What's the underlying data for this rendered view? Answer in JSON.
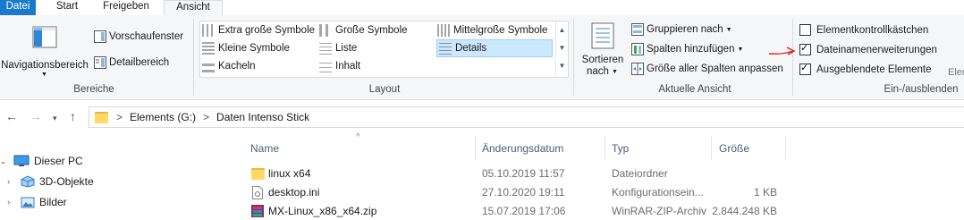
{
  "tabs": {
    "datei": "Datei",
    "start": "Start",
    "freigeben": "Freigeben",
    "ansicht": "Ansicht"
  },
  "groups": {
    "bereiche": {
      "label": "Bereiche",
      "navigation": "Navigationsbereich",
      "vorschau": "Vorschaufenster",
      "detail": "Detailbereich"
    },
    "layout": {
      "label": "Layout",
      "items": [
        "Extra große Symbole",
        "Große Symbole",
        "Mittelgroße Symbole",
        "Kleine Symbole",
        "Liste",
        "Details",
        "Kacheln",
        "Inhalt"
      ],
      "selected": "Details"
    },
    "aktuelle": {
      "label": "Aktuelle Ansicht",
      "sort_line1": "Sortieren",
      "sort_line2": "nach",
      "gruppieren": "Gruppieren nach",
      "spalten": "Spalten hinzufügen",
      "groesse": "Größe aller Spalten anpassen"
    },
    "einaus": {
      "label": "Ein-/ausblenden",
      "elementkontroll": "Elementkontrollkästchen",
      "dateinamen": "Dateinamenerweiterungen",
      "ausgeblendete": "Ausgeblendete Elemente",
      "elementkontroll_checked": false,
      "dateinamen_checked": true,
      "ausgeblendete_checked": true,
      "clipped": "Elem"
    }
  },
  "address": {
    "segments": [
      "Elements (G:)",
      "Daten Intenso Stick"
    ],
    "separator": ">"
  },
  "columns": {
    "name": "Name",
    "date": "Änderungsdatum",
    "type": "Typ",
    "size": "Größe"
  },
  "files": [
    {
      "name": "linux x64",
      "date": "05.10.2019 11:57",
      "type": "Dateiordner",
      "size": "",
      "icon": "folder-icon"
    },
    {
      "name": "desktop.ini",
      "date": "27.10.2020 19:11",
      "type": "Konfigurationsein...",
      "size": "1 KB",
      "icon": "settings-file-icon"
    },
    {
      "name": "MX-Linux_x86_x64.zip",
      "date": "15.07.2019 17:06",
      "type": "WinRAR-ZIP-Archiv",
      "size": "2.844.248 KB",
      "icon": "zip-archive-icon"
    }
  ],
  "tree": [
    {
      "label": "Dieser PC",
      "icon": "this-pc-icon",
      "expanded": true
    },
    {
      "label": "3D-Objekte",
      "icon": "3d-objects-icon",
      "expanded": false
    },
    {
      "label": "Bilder",
      "icon": "pictures-icon",
      "expanded": false
    }
  ],
  "colors": {
    "accent": "#1979ca",
    "annotation_arrow": "#e0201f",
    "ribbon_bg": "#f5f6f7",
    "selected_bg": "#cce8ff"
  }
}
